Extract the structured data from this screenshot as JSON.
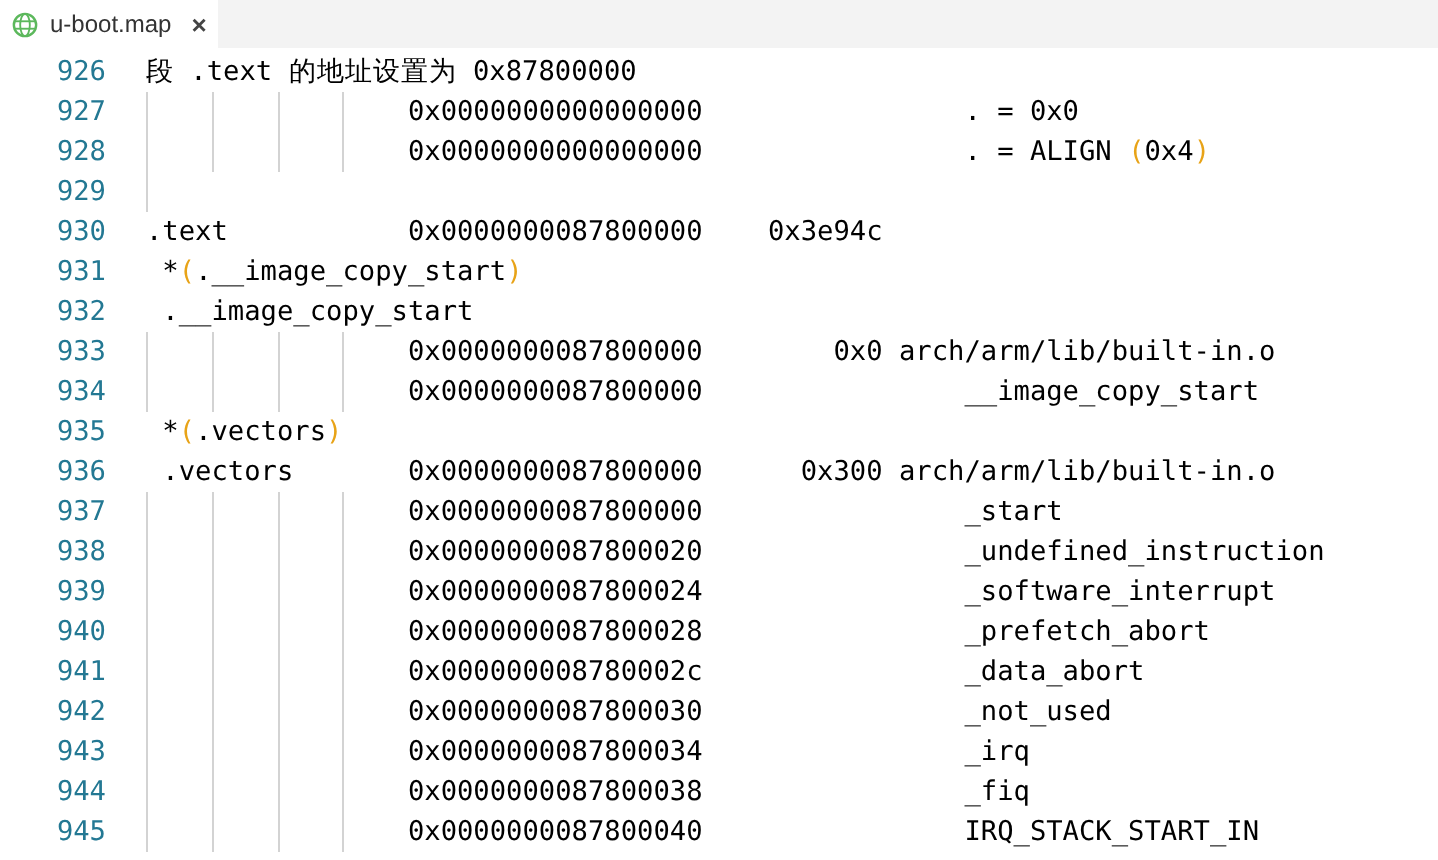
{
  "tab": {
    "title": "u-boot.map",
    "close": "×",
    "selected": true
  },
  "lines": [
    {
      "number": "926",
      "text": "段 .text 的地址设置为 0x87800000"
    },
    {
      "number": "927",
      "text": "                0x0000000000000000                . = 0x0"
    },
    {
      "number": "928",
      "text": "                0x0000000000000000                . = ALIGN (0x4)"
    },
    {
      "number": "929"
    },
    {
      "number": "930",
      "text": ".text           0x0000000087800000    0x3e94c"
    },
    {
      "number": "931",
      "text": " *(.__image_copy_start)"
    },
    {
      "number": "932",
      "text": " .__image_copy_start"
    },
    {
      "number": "933",
      "text": "                0x0000000087800000        0x0 arch/arm/lib/built-in.o"
    },
    {
      "number": "934",
      "text": "                0x0000000087800000                __image_copy_start"
    },
    {
      "number": "935",
      "text": " *(.vectors)"
    },
    {
      "number": "936",
      "text": " .vectors       0x0000000087800000      0x300 arch/arm/lib/built-in.o"
    },
    {
      "number": "937",
      "text": "                0x0000000087800000                _start"
    },
    {
      "number": "938",
      "text": "                0x0000000087800020                _undefined_instruction"
    },
    {
      "number": "939",
      "text": "                0x0000000087800024                _software_interrupt"
    },
    {
      "number": "940",
      "text": "                0x0000000087800028                _prefetch_abort"
    },
    {
      "number": "941",
      "text": "                0x000000008780002c                _data_abort"
    },
    {
      "number": "942",
      "text": "                0x0000000087800030                _not_used"
    },
    {
      "number": "943",
      "text": "                0x0000000087800034                _irq"
    },
    {
      "number": "944",
      "text": "                0x0000000087800038                _fiq"
    },
    {
      "number": "945",
      "text": "                0x0000000087800040                IRQ_STACK_START_IN"
    }
  ]
}
